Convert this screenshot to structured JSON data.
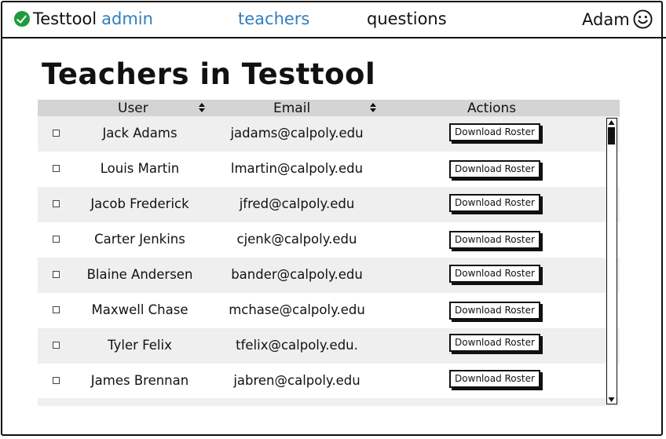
{
  "nav": {
    "brand": "Testtool",
    "brand_accent": "admin",
    "links": [
      "teachers",
      "questions"
    ],
    "user": "Adam"
  },
  "page": {
    "title": "Teachers in Testtool"
  },
  "table": {
    "columns": [
      "User",
      "Email",
      "Actions"
    ],
    "rows": [
      {
        "user": "Jack Adams",
        "email": "jadams@calpoly.edu",
        "action": "Download Roster"
      },
      {
        "user": "Louis Martin",
        "email": "lmartin@calpoly.edu",
        "action": "Download Roster"
      },
      {
        "user": "Jacob Frederick",
        "email": "jfred@calpoly.edu",
        "action": "Download Roster"
      },
      {
        "user": "Carter Jenkins",
        "email": "cjenk@calpoly.edu",
        "action": "Download Roster"
      },
      {
        "user": "Blaine Andersen",
        "email": "bander@calpoly.edu",
        "action": "Download Roster"
      },
      {
        "user": "Maxwell Chase",
        "email": "mchase@calpoly.edu",
        "action": "Download Roster"
      },
      {
        "user": "Tyler Felix",
        "email": "tfelix@calpoly.edu.",
        "action": "Download Roster"
      },
      {
        "user": "James Brennan",
        "email": "jabren@calpoly.edu",
        "action": "Download Roster"
      }
    ]
  },
  "colors": {
    "accent": "#2f7fbf",
    "check": "#1e9b3c",
    "header_bg": "#d4d4d4",
    "alt_row": "#efefef"
  }
}
